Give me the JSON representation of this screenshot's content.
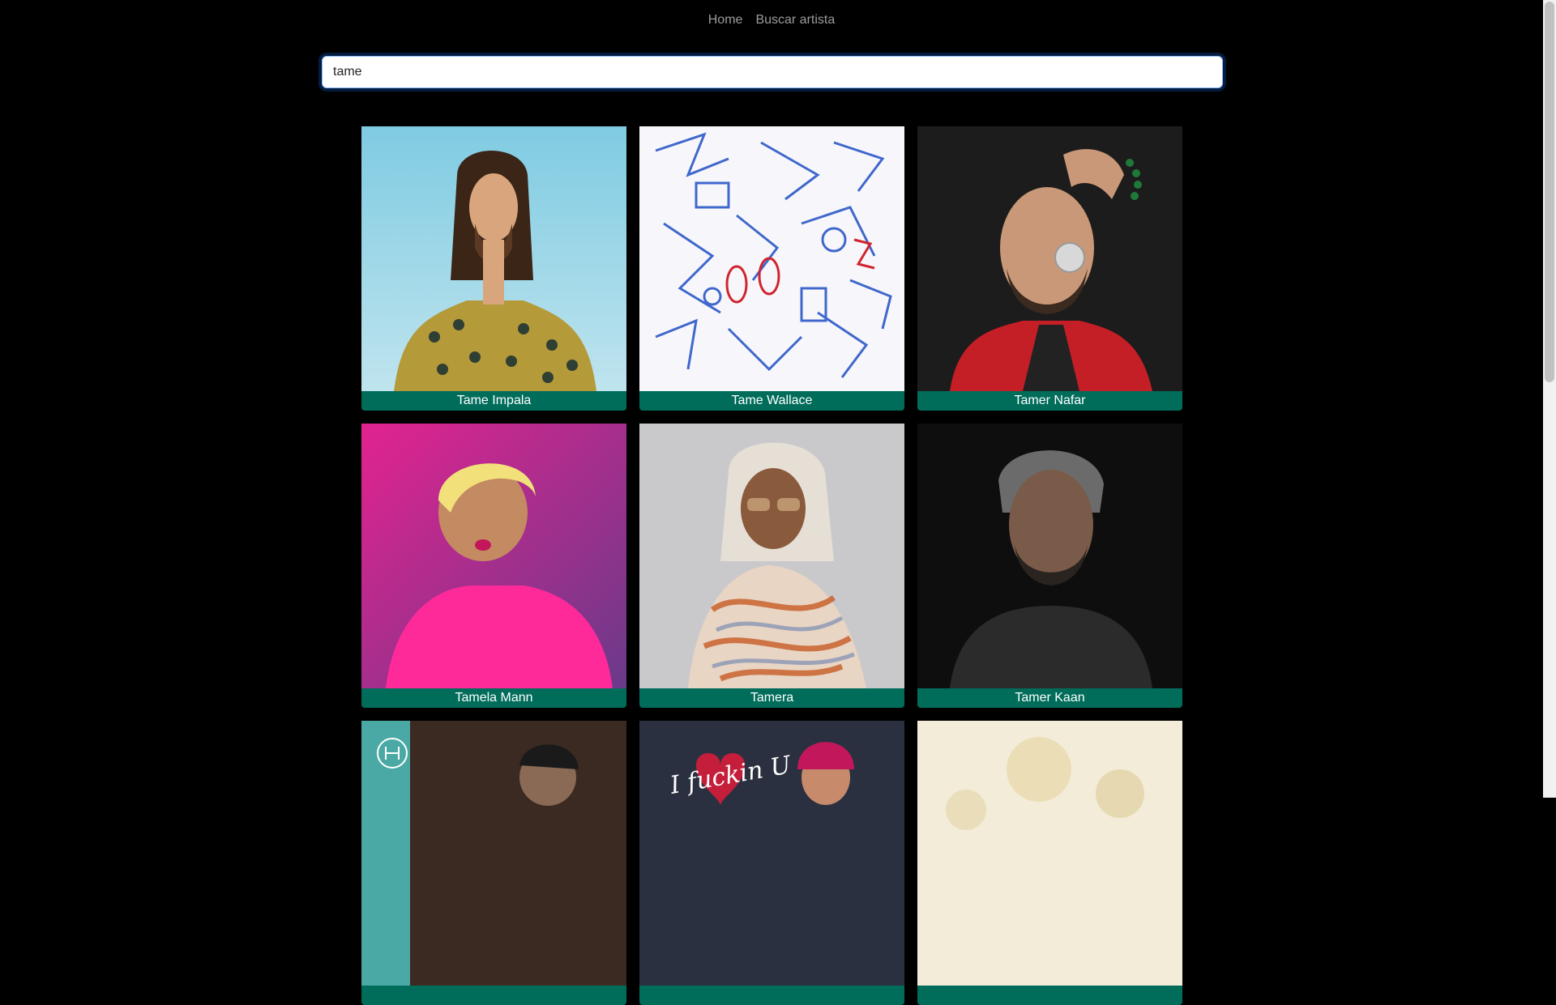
{
  "nav": {
    "home": "Home",
    "search": "Buscar artista"
  },
  "search": {
    "value": "tame"
  },
  "artists": [
    {
      "name": "Tame Impala"
    },
    {
      "name": "Tame Wallace"
    },
    {
      "name": "Tamer Nafar"
    },
    {
      "name": "Tamela Mann"
    },
    {
      "name": "Tamera"
    },
    {
      "name": "Tamer Kaan"
    },
    {
      "name": ""
    },
    {
      "name": ""
    },
    {
      "name": ""
    }
  ],
  "art_text": {
    "album_lyric": "I fuckin U"
  },
  "colors": {
    "caption_bg": "#006d5b",
    "nav_text": "#9c9c9c"
  }
}
